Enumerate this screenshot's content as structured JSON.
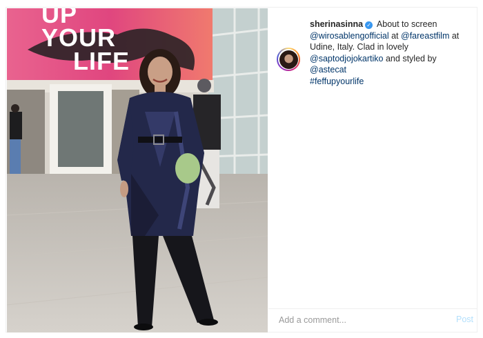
{
  "banner": {
    "line1": "UP",
    "line2": "YOUR",
    "line3": "LIFE"
  },
  "post": {
    "username": "sherinasinna",
    "verified": true,
    "caption": {
      "t1": "About to screen",
      "m1": "@wirosablengofficial",
      "t2": "at",
      "m2": "@fareastfilm",
      "t3": "at Udine, Italy. Clad in lovely",
      "m3": "@saptodjojokartiko",
      "t4": "and styled by",
      "m4": "@astecat",
      "hashtag": "#feffupyourlife"
    }
  },
  "comment": {
    "placeholder": "Add a comment...",
    "post_label": "Post"
  },
  "colors": {
    "link": "#003569",
    "verified": "#3897f0",
    "post_button": "#b2dffc",
    "banner_pink": "#e8558f"
  },
  "icons": {
    "verified": "verified-badge-icon"
  }
}
